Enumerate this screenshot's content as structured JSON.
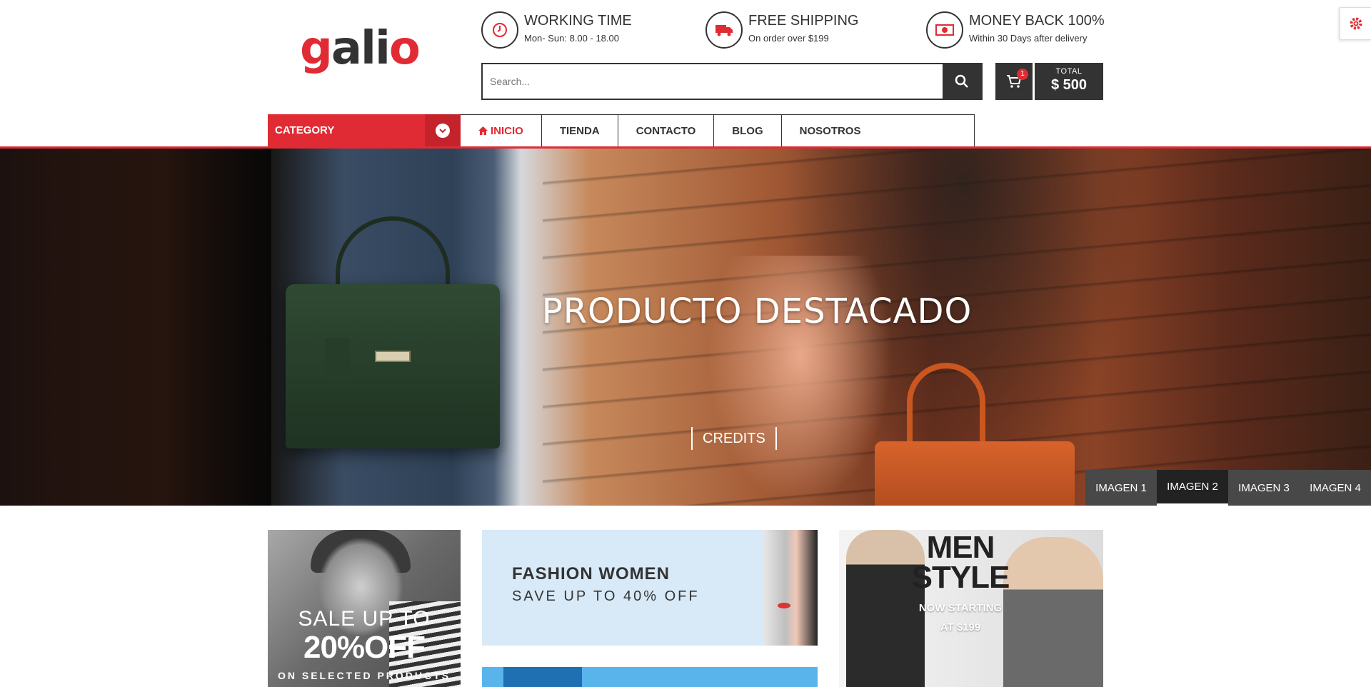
{
  "brand": {
    "logo_text": "galio",
    "accent": "#e12b34",
    "dark": "#333333"
  },
  "header": {
    "info": [
      {
        "icon": "clock-icon",
        "title": "WORKING TIME",
        "sub": "Mon- Sun: 8.00 - 18.00"
      },
      {
        "icon": "truck-icon",
        "title": "FREE SHIPPING",
        "sub": "On order over $199"
      },
      {
        "icon": "money-icon",
        "title": "MONEY BACK 100%",
        "sub": "Within 30 Days after delivery"
      }
    ],
    "search": {
      "placeholder": "Search...",
      "value": ""
    },
    "cart": {
      "count": "1",
      "total_label": "TOTAL",
      "total_value": "$ 500"
    }
  },
  "nav": {
    "category_label": "CATEGORY",
    "items": [
      {
        "label": "INICIO",
        "active": true
      },
      {
        "label": "TIENDA"
      },
      {
        "label": "CONTACTO"
      },
      {
        "label": "BLOG"
      },
      {
        "label": "NOSOTROS"
      }
    ]
  },
  "hero": {
    "title": "PRODUCTO DESTACADO",
    "credits": "CREDITS",
    "tabs": [
      "IMAGEN 1",
      "IMAGEN 2",
      "IMAGEN 3",
      "IMAGEN 4"
    ],
    "active_tab": "IMAGEN 2"
  },
  "banners": {
    "sale": {
      "line1": "SALE UP TO",
      "line2": "20%OFF",
      "line3": "ON SELECTED PRODUCTS"
    },
    "women": {
      "title": "FASHION WOMEN",
      "sub": "SAVE UP TO 40% OFF"
    },
    "men": {
      "title_line1": "MEN",
      "title_line2": "STYLE",
      "sub_line1": "NOW STARTING",
      "sub_line2": "AT $199"
    }
  }
}
